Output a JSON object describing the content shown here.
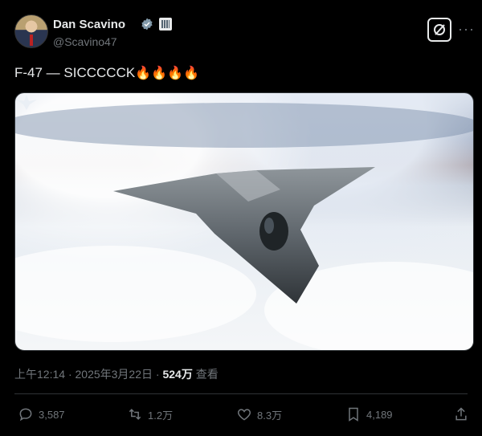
{
  "author": {
    "name": "Dan Scavino",
    "handle": "@Scavino47"
  },
  "post": {
    "text": "F-47 — SICCCCCK",
    "emoji": "🔥🔥🔥🔥"
  },
  "meta": {
    "time": "上午12:14",
    "sep1": "·",
    "date": "2025年3月22日",
    "sep2": "·",
    "views": "524万",
    "views_label": "查看"
  },
  "actions": {
    "replies": "3,587",
    "reposts": "1.2万",
    "likes": "8.3万",
    "bookmarks": "4,189"
  },
  "icons": {
    "verified": "verified-badge-icon",
    "gov": "government-badge-icon",
    "grok": "grok-icon",
    "more": "more-icon",
    "reply": "reply-icon",
    "repost": "repost-icon",
    "like": "heart-icon",
    "bookmark": "bookmark-icon",
    "share": "share-icon"
  },
  "colors": {
    "background": "#000000",
    "text": "#e7e9ea",
    "secondary": "#71767b",
    "verified": "#1d9bf0"
  }
}
